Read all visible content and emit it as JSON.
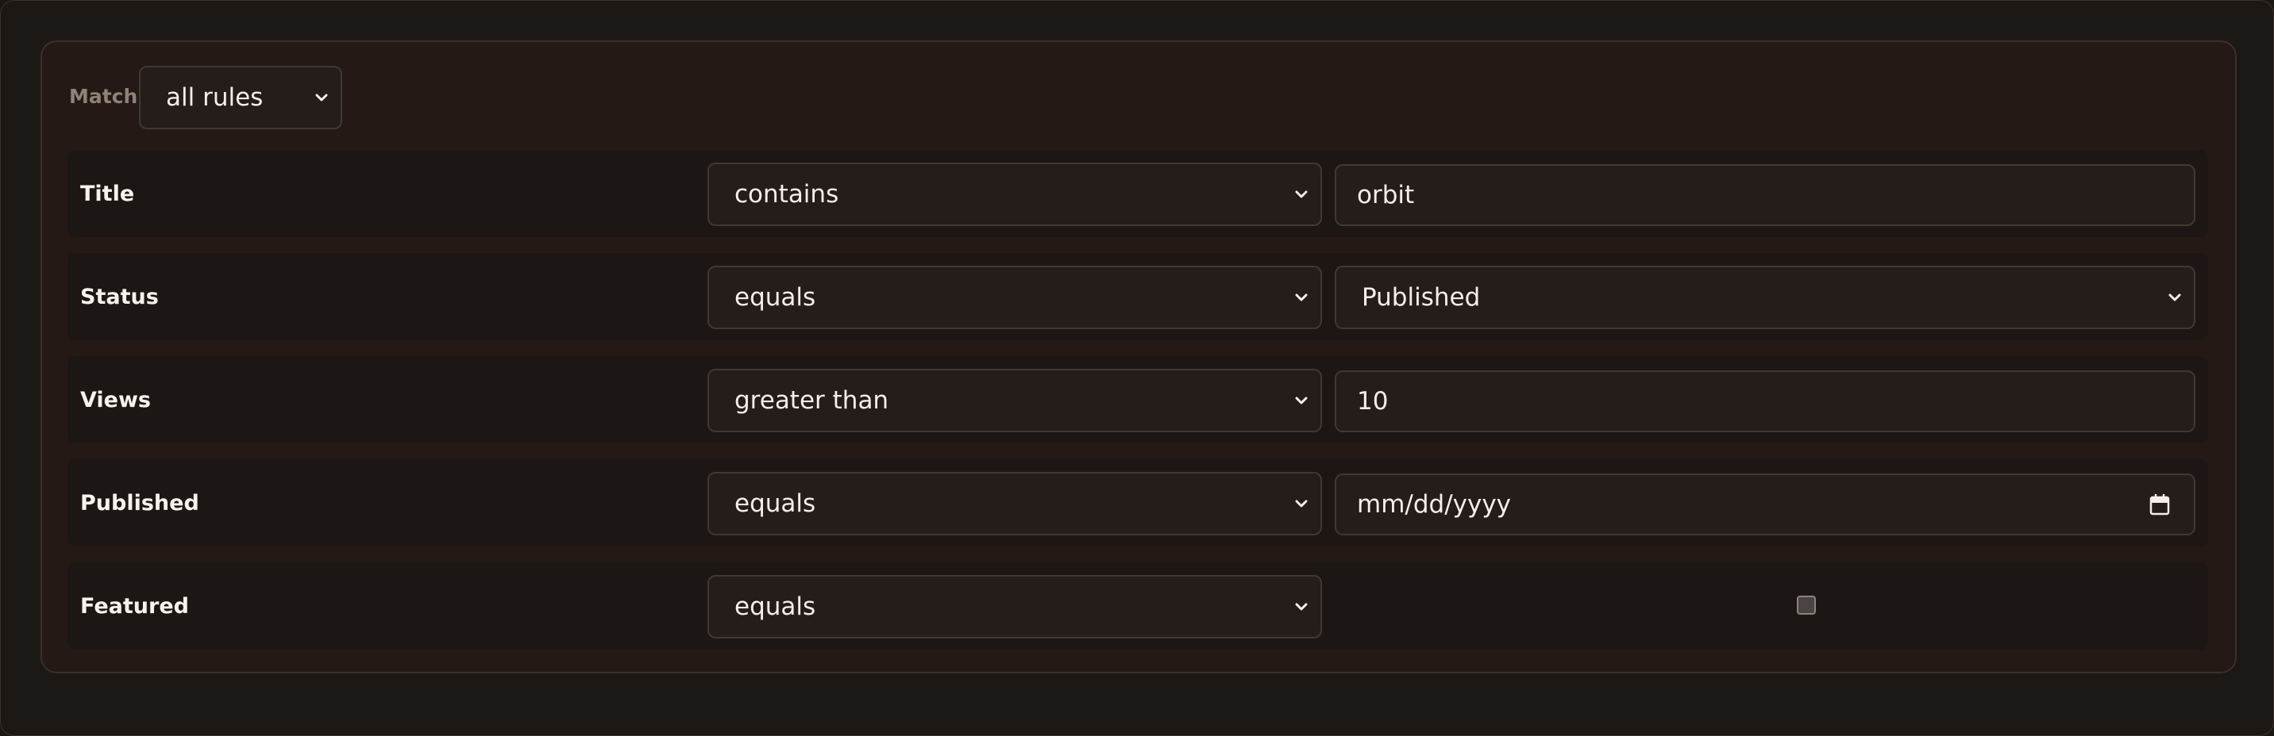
{
  "match": {
    "label": "Match",
    "selected": "all rules"
  },
  "rules": [
    {
      "field": "Title",
      "operator": "contains",
      "value": "orbit",
      "value_type": "text"
    },
    {
      "field": "Status",
      "operator": "equals",
      "value": "Published",
      "value_type": "select"
    },
    {
      "field": "Views",
      "operator": "greater than",
      "value": "10",
      "value_type": "number"
    },
    {
      "field": "Published",
      "operator": "equals",
      "value": "mm/dd/yyyy",
      "value_type": "date"
    },
    {
      "field": "Featured",
      "operator": "equals",
      "value": "",
      "value_type": "checkbox",
      "checked": false
    }
  ],
  "icons": {
    "chevron": "chevron-down-icon",
    "calendar": "calendar-icon"
  },
  "colors": {
    "background": "#1c1815",
    "panel": "#251915",
    "row": "#1c1714",
    "control": "#241d1a",
    "border": "#3f3833",
    "text": "#f4efea",
    "muted": "#8f8277"
  }
}
